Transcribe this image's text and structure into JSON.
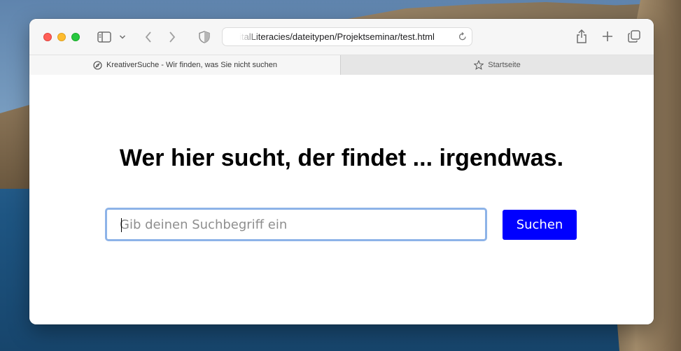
{
  "window": {
    "address": "italLiteracies/dateitypen/Projektseminar/test.html"
  },
  "tabs": [
    {
      "label": "KreativerSuche - Wir finden, was Sie nicht suchen",
      "icon": "compass-icon",
      "active": true
    },
    {
      "label": "Startseite",
      "icon": "star-icon",
      "active": false
    }
  ],
  "page": {
    "headline": "Wer hier sucht, der findet ... irgendwas.",
    "search_placeholder": "Gib deinen Suchbegriff ein",
    "search_value": "",
    "search_button": "Suchen"
  },
  "colors": {
    "search_button_bg": "#0000ff",
    "input_focus_border": "#8db3e8",
    "traffic_close": "#ff5f57",
    "traffic_minimize": "#febc2e",
    "traffic_maximize": "#28c840"
  }
}
